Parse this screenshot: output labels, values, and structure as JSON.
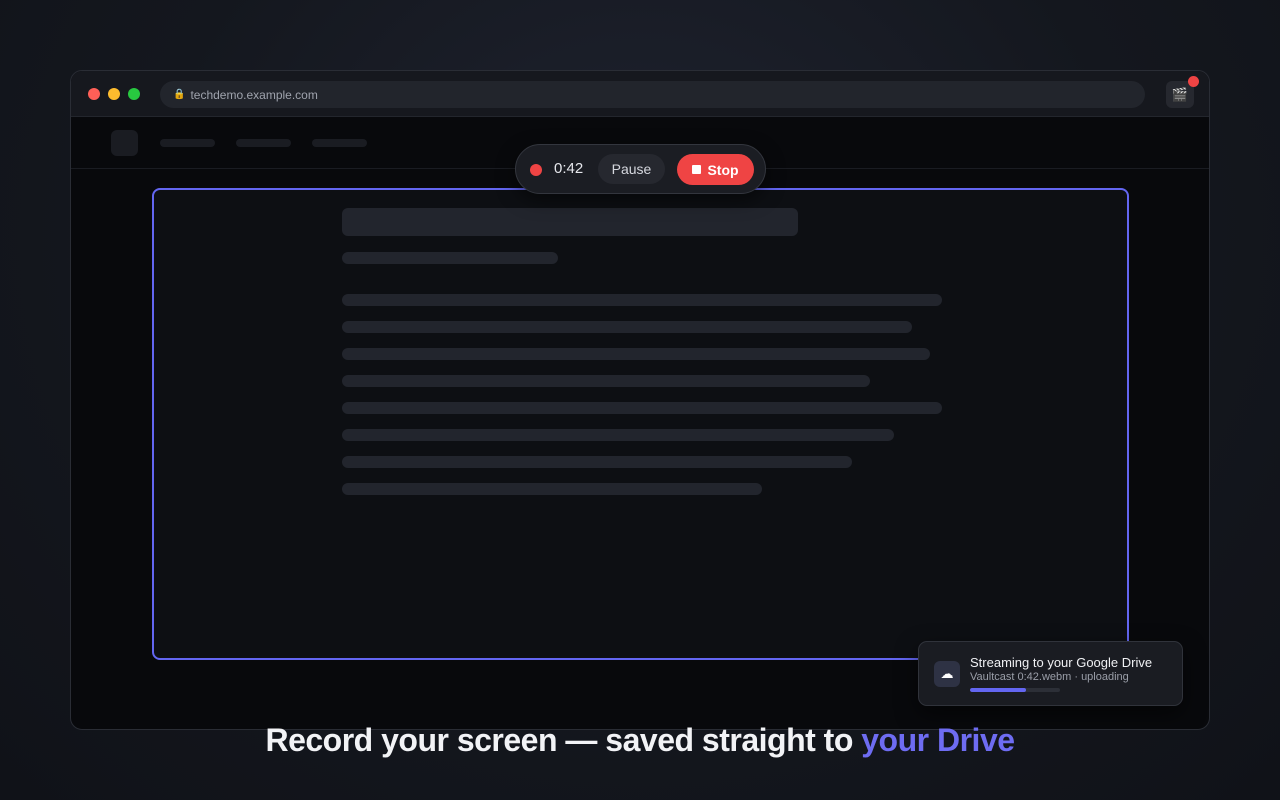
{
  "browser": {
    "url": "techdemo.example.com",
    "lock_icon": "lock-icon",
    "extension_icon": "clapperboard-icon",
    "traffic_lights": [
      "#ff5f57",
      "#febc2e",
      "#28c840"
    ]
  },
  "recorder": {
    "status": "recording",
    "elapsed": "0:42",
    "pause_label": "Pause",
    "stop_label": "Stop",
    "accent_color": "#6366f1",
    "stop_color": "#ef4444"
  },
  "toast": {
    "icon": "cloud-icon",
    "title": "Streaming to your Google Drive",
    "subtitle": "Vaultcast 0:42.webm · uploading",
    "progress": 0.62
  },
  "headline": {
    "main": "Record your screen — saved straight to ",
    "accent": "your Drive"
  }
}
